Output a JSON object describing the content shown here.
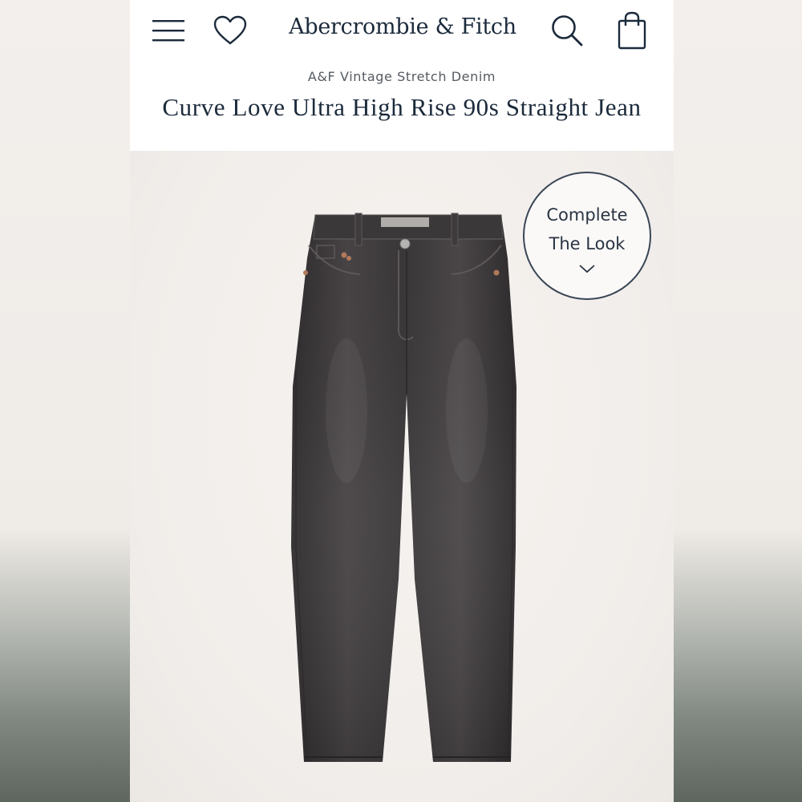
{
  "header": {
    "brand": "Abercrombie & Fitch",
    "icons": {
      "menu": "menu-icon",
      "wishlist": "heart-icon",
      "search": "search-icon",
      "bag": "shopping-bag-icon"
    }
  },
  "product": {
    "collection": "A&F Vintage Stretch Denim",
    "title": "Curve Love Ultra High Rise 90s Straight Jean",
    "image_alt_icon": "jeans-image"
  },
  "complete_look": {
    "label": "Complete The Look",
    "icon": "chevron-down-icon"
  },
  "colors": {
    "brand_navy": "#1b2a3b",
    "denim": "#3d3a3b"
  }
}
